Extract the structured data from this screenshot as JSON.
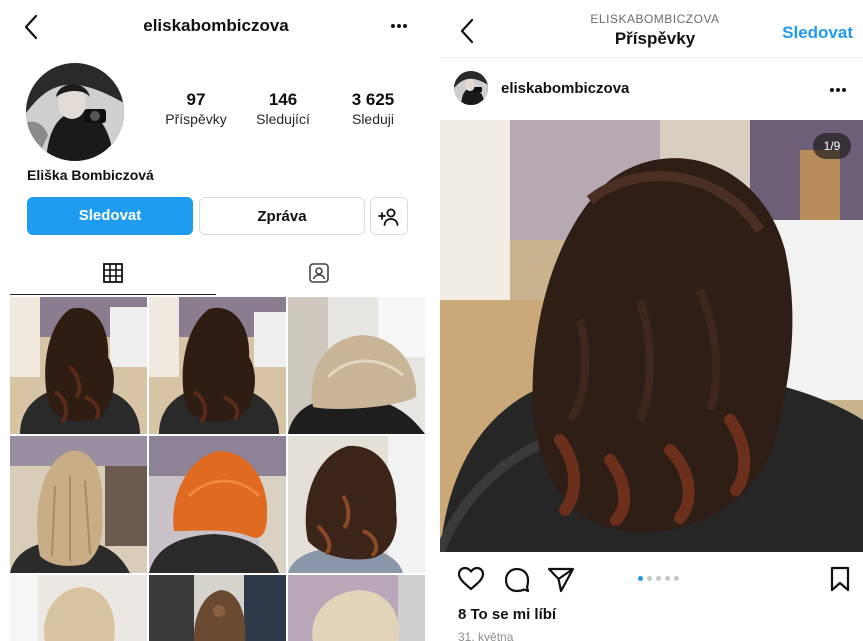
{
  "profile": {
    "username": "eliskabombiczova",
    "full_name": "Eliška Bombiczová",
    "stats": {
      "posts_count": "97",
      "posts_label": "Příspěvky",
      "followers_count": "146",
      "followers_label": "Sledující",
      "following_count": "3 625",
      "following_label": "Sleduji"
    },
    "follow_label": "Sledovat",
    "message_label": "Zpráva",
    "add_friend_icon": "add-person-icon",
    "tabs": [
      {
        "icon": "grid-icon",
        "active": true
      },
      {
        "icon": "tagged-icon",
        "active": false
      }
    ]
  },
  "post_view": {
    "header_subtitle": "ELISKABOMBICZOVA",
    "header_title": "Příspěvky",
    "follow_label": "Sledovat",
    "username": "eliskabombiczova",
    "image_counter": "1/9",
    "carousel_pages": 5,
    "active_page": 1,
    "likes": "8 To se mi líbí",
    "date": "31. května"
  },
  "colors": {
    "accent": "#1f9bf0",
    "text": "#262626",
    "muted": "#8e8e8e",
    "border": "#dbdbdb"
  }
}
